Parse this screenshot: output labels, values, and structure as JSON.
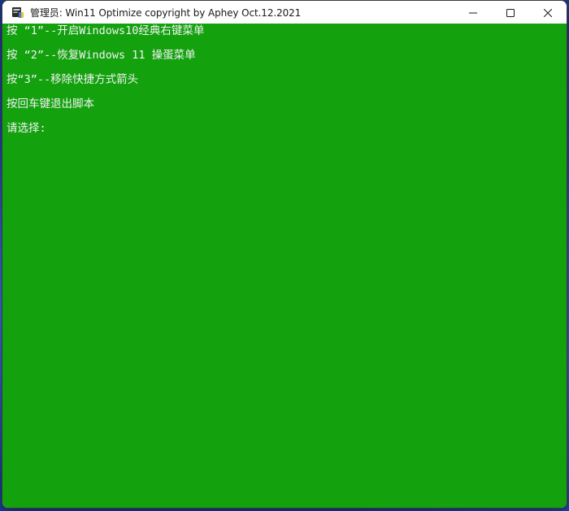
{
  "window": {
    "title": "管理员:  Win11 Optimize copyright by Aphey Oct.12.2021",
    "app_icon": "console-admin-icon",
    "controls": {
      "minimize_icon": "minimize-icon",
      "maximize_icon": "maximize-icon",
      "close_icon": "close-icon"
    }
  },
  "console": {
    "background_color": "#13a10e",
    "text_color": "#f2f2f2",
    "lines": [
      "按 “1”--开启Windows10经典右键菜单",
      "按 “2”--恢复Windows 11 操蛋菜单",
      "按“3”--移除快捷方式箭头",
      "按回车键退出脚本",
      "请选择:"
    ]
  }
}
